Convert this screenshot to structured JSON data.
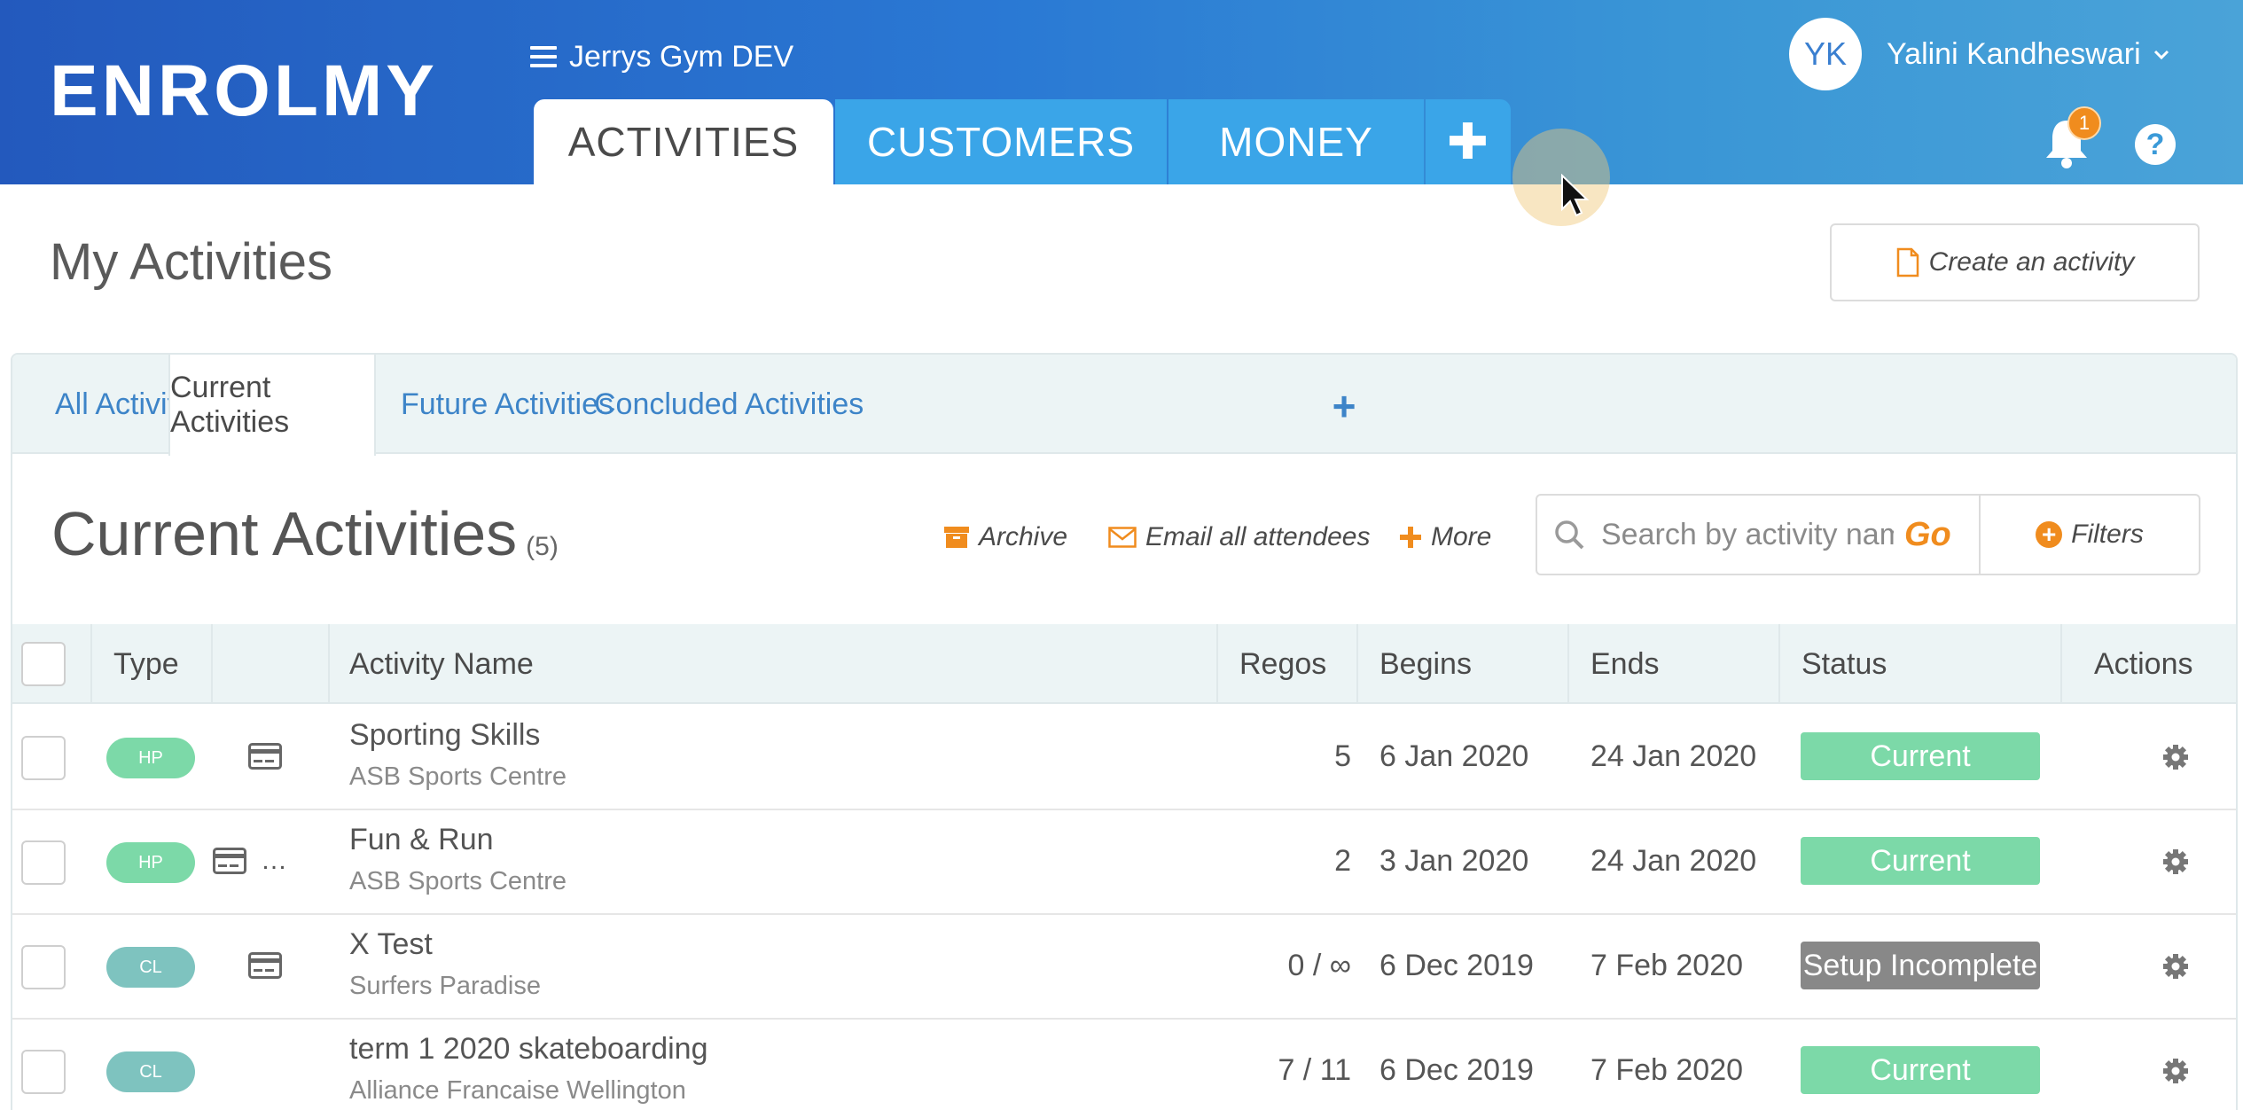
{
  "app": {
    "logo_text": "ENROLMY",
    "org_name": "Jerrys Gym DEV"
  },
  "main_tabs": [
    {
      "label": "ACTIVITIES",
      "active": true
    },
    {
      "label": "CUSTOMERS",
      "active": false
    },
    {
      "label": "MONEY",
      "active": false
    },
    {
      "label": "✚",
      "active": false
    }
  ],
  "user": {
    "initials": "YK",
    "name": "Yalini Kandheswari",
    "notification_count": "1",
    "help_label": "?"
  },
  "page": {
    "title": "My Activities",
    "create_button": "Create an activity"
  },
  "sub_tabs": [
    {
      "label": "All Activities",
      "active": false
    },
    {
      "label": "Current Activities",
      "active": true
    },
    {
      "label": "Future Activities",
      "active": false
    },
    {
      "label": "Concluded Activities",
      "active": false
    }
  ],
  "sub_tab_add": "+",
  "list": {
    "title": "Current Activities",
    "count": "(5)",
    "archive": "Archive",
    "email": "Email all attendees",
    "more": "More",
    "search_placeholder": "Search by activity name",
    "go": "Go",
    "filters": "Filters"
  },
  "table": {
    "headers": {
      "type": "Type",
      "name": "Activity Name",
      "regos": "Regos",
      "begins": "Begins",
      "ends": "Ends",
      "status": "Status",
      "actions": "Actions"
    },
    "rows": [
      {
        "type": "HP",
        "name": "Sporting Skills",
        "venue": "ASB Sports Centre",
        "regos": "5",
        "begins": "6 Jan 2020",
        "ends": "24 Jan 2020",
        "status": "Current"
      },
      {
        "type": "HP",
        "name": "Fun & Run",
        "venue": "ASB Sports Centre",
        "regos": "2",
        "begins": "3 Jan 2020",
        "ends": "24 Jan 2020",
        "status": "Current",
        "extra": "…"
      },
      {
        "type": "CL",
        "name": "X Test",
        "venue": "Surfers Paradise",
        "regos": "0 / ∞",
        "begins": "6 Dec 2019",
        "ends": "7 Feb 2020",
        "status": "Setup Incomplete"
      },
      {
        "type": "CL",
        "name": "term 1 2020 skateboarding",
        "venue": "Alliance Francaise Wellington",
        "regos": "7 / 11",
        "begins": "6 Dec 2019",
        "ends": "7 Feb 2020",
        "status": "Current"
      }
    ]
  },
  "colors": {
    "header_start": "#2359bd",
    "header_end": "#4aa3d8",
    "tab_blue": "#3aa5e8",
    "accent_orange": "#f08c1e",
    "link_blue": "#3d84c8",
    "status_current": "#7cd9a8",
    "status_incomplete": "#888888"
  }
}
